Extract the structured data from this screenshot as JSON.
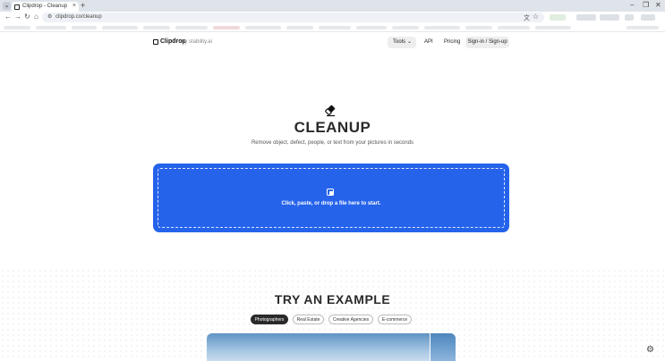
{
  "browser": {
    "tab_title": "Clipdrop - Cleanup",
    "tab_close": "×",
    "new_tab": "+",
    "url": "clipdrop.co/cleanup",
    "back": "←",
    "forward": "→",
    "reload": "↻",
    "home": "⌂",
    "minimize": "–",
    "restore": "❐",
    "close": "✕",
    "star": "☆",
    "translate": "文"
  },
  "site_header": {
    "logo": "Clipdrop",
    "by": "by stability.ai",
    "nav_tools": "Tools",
    "nav_api": "API",
    "nav_pricing": "Pricing",
    "nav_signin": "Sign-in / Sign-up"
  },
  "hero": {
    "title": "CLEANUP",
    "subtitle": "Remove object, defect, people, or text from your pictures in seconds",
    "dropzone_text": "Click, paste, or drop a file here to start."
  },
  "examples": {
    "title": "TRY AN EXAMPLE",
    "tabs": [
      "Photographers",
      "Real Estate",
      "Creative Agencies",
      "E-commerce"
    ],
    "active_tab": "Photographers"
  },
  "colors": {
    "accent": "#2563eb",
    "dark": "#2a2a2a"
  },
  "icons": {
    "eraser": "eraser-icon",
    "upload": "upload-icon",
    "settings": "gear-icon"
  }
}
